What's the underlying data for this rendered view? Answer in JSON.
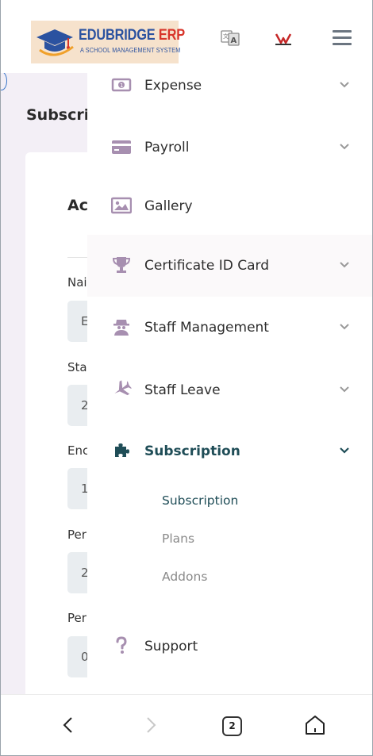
{
  "header": {
    "logo_title_part1": "EDUBRIDGE",
    "logo_title_part2": " ERP",
    "logo_subtitle": "A SCHOOL MANAGEMENT SYSTEM",
    "icons": [
      "graduation-cap-icon",
      "translate-icon",
      "brand-logo-icon",
      "hamburger-menu-icon"
    ]
  },
  "background_page": {
    "title": "Subscri",
    "card_heading": "Ac",
    "fields": [
      {
        "label": "Nai",
        "value": "E"
      },
      {
        "label": "Sta",
        "value": "2"
      },
      {
        "label": "Enc",
        "value": "1"
      },
      {
        "label": "Per",
        "value": "2"
      },
      {
        "label": "Per",
        "value": "0"
      }
    ]
  },
  "sidebar": {
    "items": [
      {
        "label": "Expense",
        "icon": "money-bill-icon",
        "has_chevron": true
      },
      {
        "label": "Payroll",
        "icon": "credit-card-icon",
        "has_chevron": true
      },
      {
        "label": "Gallery",
        "icon": "image-icon",
        "has_chevron": false
      },
      {
        "label": "Certificate ID Card",
        "icon": "trophy-icon",
        "has_chevron": true
      },
      {
        "label": "Staff Management",
        "icon": "user-secret-icon",
        "has_chevron": true
      },
      {
        "label": "Staff Leave",
        "icon": "plane-icon",
        "has_chevron": true
      },
      {
        "label": "Subscription",
        "icon": "puzzle-piece-icon",
        "has_chevron": true,
        "active": true
      },
      {
        "label": "Support",
        "icon": "question-icon",
        "has_chevron": false
      }
    ],
    "subscription_submenu": [
      {
        "label": "Subscription",
        "active": true
      },
      {
        "label": "Plans",
        "active": false
      },
      {
        "label": "Addons",
        "active": false
      }
    ]
  },
  "bottom_bar": {
    "tab_count": "2",
    "icons": [
      "back-arrow-icon",
      "forward-arrow-icon",
      "tabs-icon",
      "home-icon"
    ]
  },
  "colors": {
    "icon_purple": "#a78fb0",
    "active_teal": "#1f4d57",
    "background_lavender": "#f3eff6",
    "input_gray": "#e9edf0",
    "logo_blue": "#2b52a0",
    "logo_red": "#d8352a"
  }
}
